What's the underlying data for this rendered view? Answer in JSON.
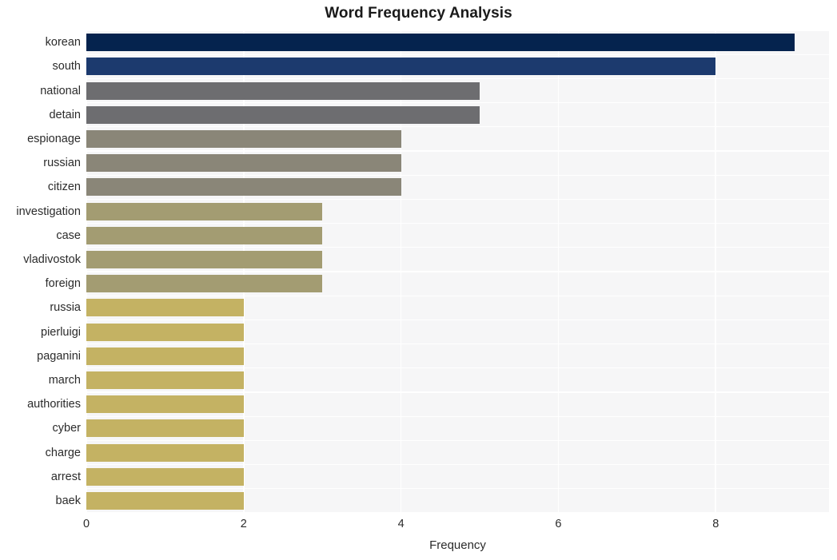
{
  "chart_data": {
    "type": "bar",
    "orientation": "horizontal",
    "title": "Word Frequency Analysis",
    "xlabel": "Frequency",
    "ylabel": "",
    "categories": [
      "korean",
      "south",
      "national",
      "detain",
      "espionage",
      "russian",
      "citizen",
      "investigation",
      "case",
      "vladivostok",
      "foreign",
      "russia",
      "pierluigi",
      "paganini",
      "march",
      "authorities",
      "cyber",
      "charge",
      "arrest",
      "baek"
    ],
    "values": [
      9,
      8,
      5,
      5,
      4,
      4,
      4,
      3,
      3,
      3,
      3,
      2,
      2,
      2,
      2,
      2,
      2,
      2,
      2,
      2
    ],
    "bar_colors": [
      "#05234e",
      "#1c3a6e",
      "#6d6d70",
      "#6d6d70",
      "#8a8678",
      "#8a8678",
      "#8a8678",
      "#a39c72",
      "#a39c72",
      "#a39c72",
      "#a39c72",
      "#c4b263",
      "#c4b263",
      "#c4b263",
      "#c4b263",
      "#c4b263",
      "#c4b263",
      "#c4b263",
      "#c4b263",
      "#c4b263"
    ],
    "xlim": [
      0,
      9.44
    ],
    "xticks": [
      0,
      2,
      4,
      6,
      8
    ],
    "xtick_labels": [
      "0",
      "2",
      "4",
      "6",
      "8"
    ],
    "grid": true,
    "grid_color": "#ffffff",
    "plot_background": "#f6f6f7",
    "figure_background": "#ffffff",
    "legend": null
  }
}
